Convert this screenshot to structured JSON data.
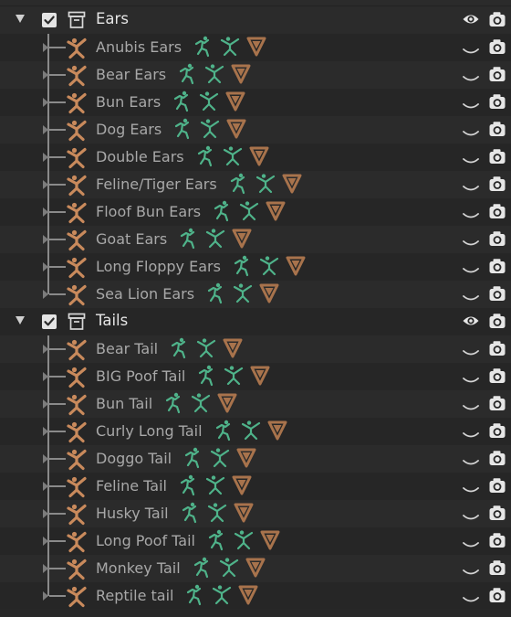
{
  "collections": [
    {
      "name": "Ears",
      "objects": [
        {
          "name": "Anubis Ears"
        },
        {
          "name": "Bear Ears"
        },
        {
          "name": "Bun Ears"
        },
        {
          "name": "Dog Ears"
        },
        {
          "name": "Double Ears"
        },
        {
          "name": "Feline/Tiger Ears"
        },
        {
          "name": "Floof Bun Ears"
        },
        {
          "name": "Goat Ears"
        },
        {
          "name": "Long Floppy Ears"
        },
        {
          "name": "Sea Lion Ears"
        }
      ]
    },
    {
      "name": "Tails",
      "objects": [
        {
          "name": "Bear Tail"
        },
        {
          "name": "BIG Poof Tail"
        },
        {
          "name": "Bun Tail"
        },
        {
          "name": "Curly Long Tail"
        },
        {
          "name": "Doggo Tail"
        },
        {
          "name": "Feline Tail"
        },
        {
          "name": "Husky Tail"
        },
        {
          "name": "Long Poof Tail"
        },
        {
          "name": "Monkey Tail"
        },
        {
          "name": "Reptile tail"
        }
      ]
    }
  ],
  "icons": {
    "collection_row": [
      "expand-triangle-icon",
      "checkbox-icon",
      "collection-icon",
      "eye-icon",
      "camera-icon"
    ],
    "object_row": [
      "armature-icon",
      "pose-icon",
      "armature-data-icon",
      "vertex-group-icon",
      "hide-in-viewport-icon",
      "camera-icon"
    ]
  },
  "colors": {
    "background": "#282828",
    "row_alt": "#2b2b2b",
    "armature_orange": "#c98a5c",
    "pose_green": "#4fb38a",
    "vertex_brown": "#a8734c",
    "text_collection": "#e6e6e6",
    "text_object": "#a8a8a8"
  }
}
